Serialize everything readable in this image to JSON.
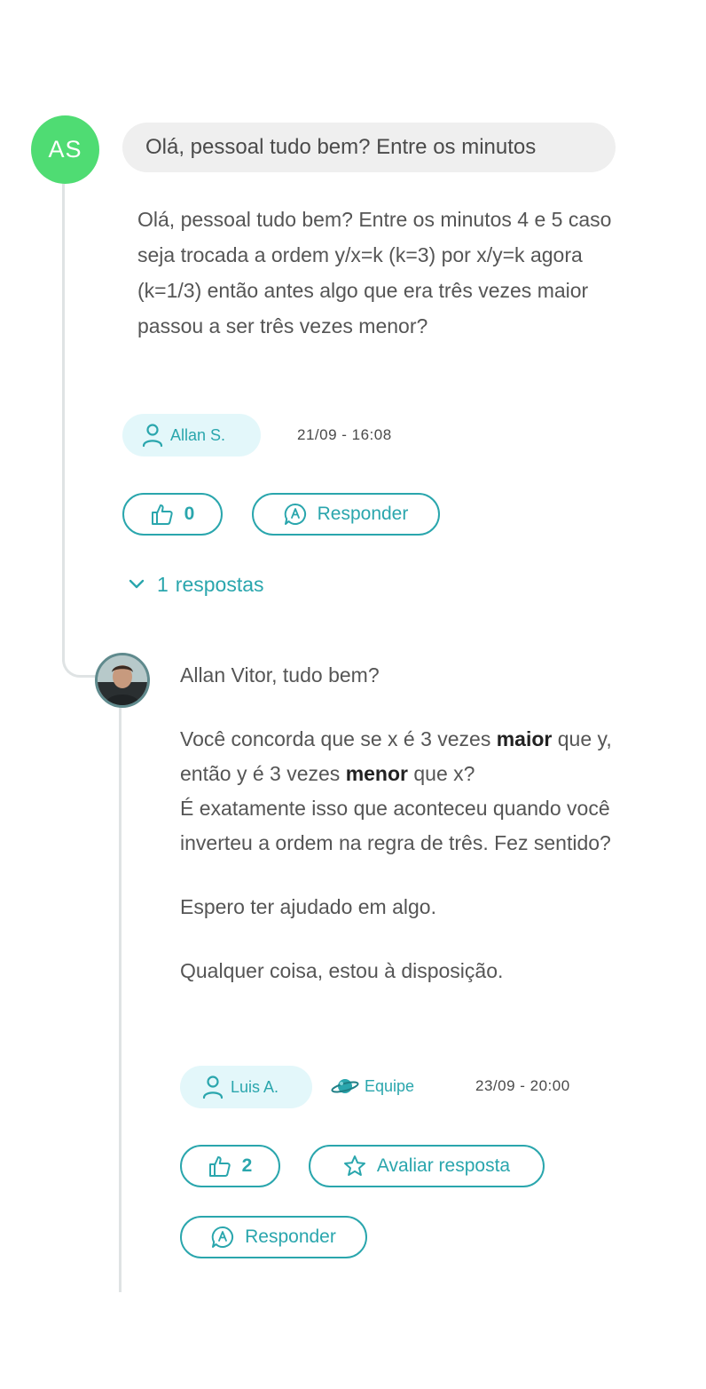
{
  "question": {
    "avatar_initials": "AS",
    "title": "Olá, pessoal tudo bem? Entre os minutos",
    "body": "Olá, pessoal tudo bem? Entre os minutos 4 e 5 caso seja trocada a ordem y/x=k (k=3) por x/y=k agora (k=1/3) então antes algo que era três vezes maior passou a ser três vezes menor?",
    "author": "Allan S.",
    "date": "21/09 - 16:08",
    "like_count": "0",
    "reply_label": "Responder",
    "replies_count": "1",
    "replies_label": "respostas"
  },
  "answer": {
    "greeting": "Allan Vitor, tudo bem?",
    "p1_a": "Você concorda que se x é 3 vezes ",
    "p1_b1": "maior",
    "p1_c": " que y, então y é 3 vezes ",
    "p1_b2": "menor",
    "p1_d": " que x?",
    "p1_e": "É exatamente isso que aconteceu quando você inverteu a ordem na regra de três. Fez sentido?",
    "p2": "Espero ter ajudado em algo.",
    "p3": "Qualquer coisa, estou à disposição.",
    "author": "Luis A.",
    "team_label": "Equipe",
    "date": "23/09 - 20:00",
    "like_count": "2",
    "rate_label": "Avaliar resposta",
    "reply_label": "Responder"
  },
  "colors": {
    "accent": "#2aa6ad",
    "avatar_green": "#4fdc73",
    "chip_bg": "#e3f7fa",
    "title_bg": "#efefef",
    "thread_line": "#dfe3e4"
  },
  "icons": [
    "user-icon",
    "thumbs-up-icon",
    "chat-bubble-icon",
    "chevron-down-icon",
    "team-planet-icon",
    "star-icon"
  ]
}
